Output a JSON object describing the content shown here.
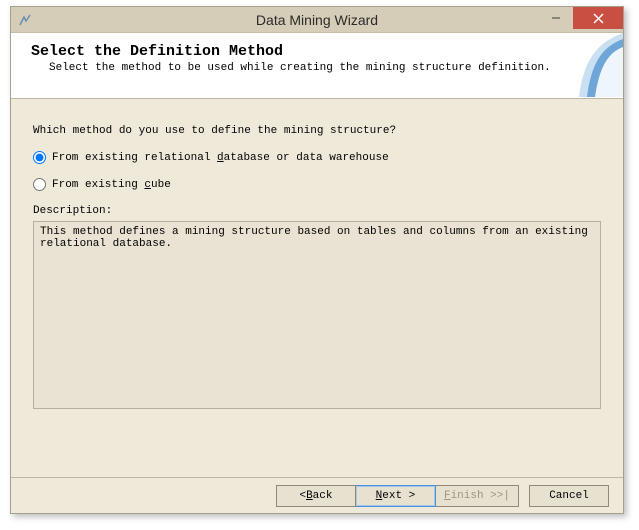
{
  "window": {
    "title": "Data Mining Wizard"
  },
  "header": {
    "title": "Select the Definition Method",
    "subtitle": "Select the method to be used while creating the mining structure definition."
  },
  "body": {
    "prompt": "Which method do you use to define the mining structure?",
    "option1_pre": "From existing relational ",
    "option1_u": "d",
    "option1_post": "atabase or data warehouse",
    "option2_pre": "From existing ",
    "option2_u": "c",
    "option2_post": "ube",
    "description_label": "Description:",
    "description_text": "This method defines a mining structure based on tables and columns from an existing relational database."
  },
  "footer": {
    "back_pre": "< ",
    "back_u": "B",
    "back_post": "ack",
    "next_u": "N",
    "next_post": "ext >",
    "finish_u": "F",
    "finish_post": "inish >>|",
    "cancel": "Cancel"
  }
}
